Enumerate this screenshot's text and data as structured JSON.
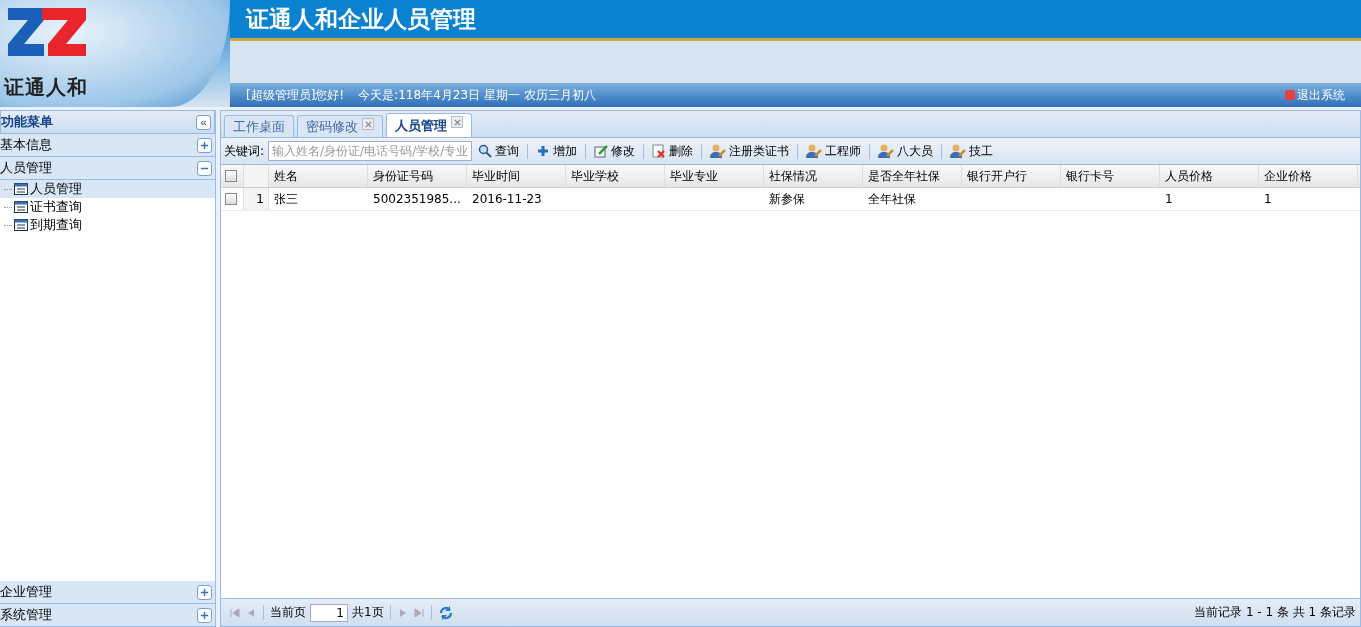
{
  "header": {
    "logo_text": "证通人和",
    "title": "证通人和企业人员管理",
    "greeting": "[超级管理员]您好!",
    "date": "今天是:118年4月23日 星期一 农历三月初八",
    "logout": "退出系统"
  },
  "sidebar": {
    "title": "功能菜单",
    "collapse_glyph": "«",
    "sections": [
      {
        "label": "基本信息",
        "expanded": false
      },
      {
        "label": "人员管理",
        "expanded": true,
        "items": [
          {
            "label": "人员管理",
            "selected": true
          },
          {
            "label": "证书查询",
            "selected": false
          },
          {
            "label": "到期查询",
            "selected": false
          }
        ]
      },
      {
        "label": "企业管理",
        "expanded": false
      },
      {
        "label": "系统管理",
        "expanded": false
      }
    ]
  },
  "tabs": [
    {
      "label": "工作桌面",
      "selected": false,
      "closable": false
    },
    {
      "label": "密码修改",
      "selected": false,
      "closable": true
    },
    {
      "label": "人员管理",
      "selected": true,
      "closable": true
    }
  ],
  "toolbar": {
    "keyword_label": "关键词:",
    "search": {
      "placeholder": "输入姓名/身份证/电话号码/学校/专业"
    },
    "buttons": [
      {
        "label": "查询",
        "kind": "search"
      },
      {
        "label": "增加",
        "kind": "add"
      },
      {
        "label": "修改",
        "kind": "edit"
      },
      {
        "label": "删除",
        "kind": "delete"
      },
      {
        "label": "注册类证书",
        "kind": "person"
      },
      {
        "label": "工程师",
        "kind": "person"
      },
      {
        "label": "八大员",
        "kind": "person"
      },
      {
        "label": "技工",
        "kind": "person"
      }
    ]
  },
  "table": {
    "all_checked": false,
    "columns": [
      "姓名",
      "身份证号码",
      "毕业时间",
      "毕业学校",
      "毕业专业",
      "社保情况",
      "是否全年社保",
      "银行开户行",
      "银行卡号",
      "人员价格",
      "企业价格"
    ],
    "rows": [
      {
        "number": "1",
        "checked": false,
        "cells": [
          "张三",
          "5002351985...",
          "2016-11-23",
          "",
          "",
          "新参保",
          "全年社保",
          "",
          "",
          "1",
          "1"
        ]
      }
    ]
  },
  "pager": {
    "page_label": "当前页",
    "page": "1",
    "total_pages": "共1页",
    "summary": "当前记录 1 - 1 条 共 1 条记录"
  }
}
